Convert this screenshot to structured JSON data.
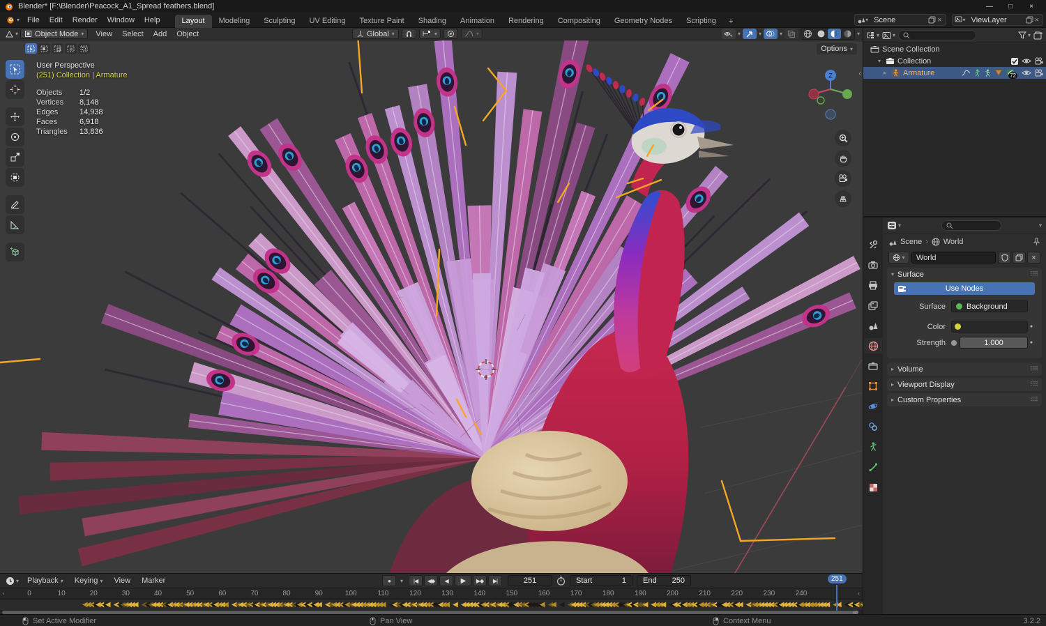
{
  "icons": {
    "dropdown": "▾",
    "disclosure_open": "▾",
    "disclosure_closed": "▸",
    "close": "×",
    "minimize": "—",
    "maximize": "□",
    "check": "✓",
    "collapse": "‹",
    "expand": "›",
    "breadcrumb_sep": "›",
    "record": "●",
    "jump_first": "|◀",
    "prev_key": "◀◆",
    "prev_frame": "◀",
    "play": "▶",
    "next_key": "▶◆",
    "jump_last": "▶|",
    "grip": "⠿⠿",
    "plus": "+"
  },
  "titlebar": {
    "title": "Blender* [F:\\Blender\\Peacock_A1_Spread feathers.blend]"
  },
  "topbar": {
    "menus": [
      "File",
      "Edit",
      "Render",
      "Window",
      "Help"
    ],
    "tabs": [
      "Layout",
      "Modeling",
      "Sculpting",
      "UV Editing",
      "Texture Paint",
      "Shading",
      "Animation",
      "Rendering",
      "Compositing",
      "Geometry Nodes",
      "Scripting"
    ],
    "scene_label": "Scene",
    "viewlayer_label": "ViewLayer"
  },
  "viewport": {
    "mode": "Object Mode",
    "menus": [
      "View",
      "Select",
      "Add",
      "Object"
    ],
    "orientation": "Global",
    "options_label": "Options",
    "gizmo_z": "Z",
    "overlay": {
      "perspective": "User Perspective",
      "context": "(251) Collection | Armature",
      "stats": [
        {
          "label": "Objects",
          "value": "1/2"
        },
        {
          "label": "Vertices",
          "value": "8,148"
        },
        {
          "label": "Edges",
          "value": "14,938"
        },
        {
          "label": "Faces",
          "value": "6,918"
        },
        {
          "label": "Triangles",
          "value": "13,836"
        }
      ]
    }
  },
  "outliner": {
    "items": [
      {
        "label": "Scene Collection"
      },
      {
        "label": "Collection"
      },
      {
        "label": "Armature",
        "badge": "72"
      }
    ]
  },
  "properties": {
    "breadcrumb": {
      "scene": "Scene",
      "world": "World"
    },
    "world_name": "World",
    "surface": {
      "title": "Surface",
      "use_nodes": "Use Nodes",
      "surface_label": "Surface",
      "surface_value": "Background",
      "color_label": "Color",
      "strength_label": "Strength",
      "strength_value": "1.000"
    },
    "panels": [
      "Volume",
      "Viewport Display",
      "Custom Properties"
    ]
  },
  "timeline": {
    "menus": [
      "Playback",
      "Keying",
      "View",
      "Marker"
    ],
    "current_frame": "251",
    "start_label": "Start",
    "start_value": "1",
    "end_label": "End",
    "end_value": "250",
    "ticks": [
      "0",
      "10",
      "20",
      "30",
      "40",
      "50",
      "60",
      "70",
      "80",
      "90",
      "100",
      "110",
      "120",
      "130",
      "140",
      "150",
      "160",
      "170",
      "180",
      "190",
      "200",
      "210",
      "220",
      "230",
      "240"
    ]
  },
  "statusbar": {
    "items": [
      "Set Active Modifier",
      "Pan View",
      "Context Menu"
    ],
    "version": "3.2.2"
  },
  "colors": {
    "accent": "#4772b3",
    "selection": "#3d5a86",
    "active_text": "#ffb15e",
    "keyframe": "#e0b13c"
  }
}
